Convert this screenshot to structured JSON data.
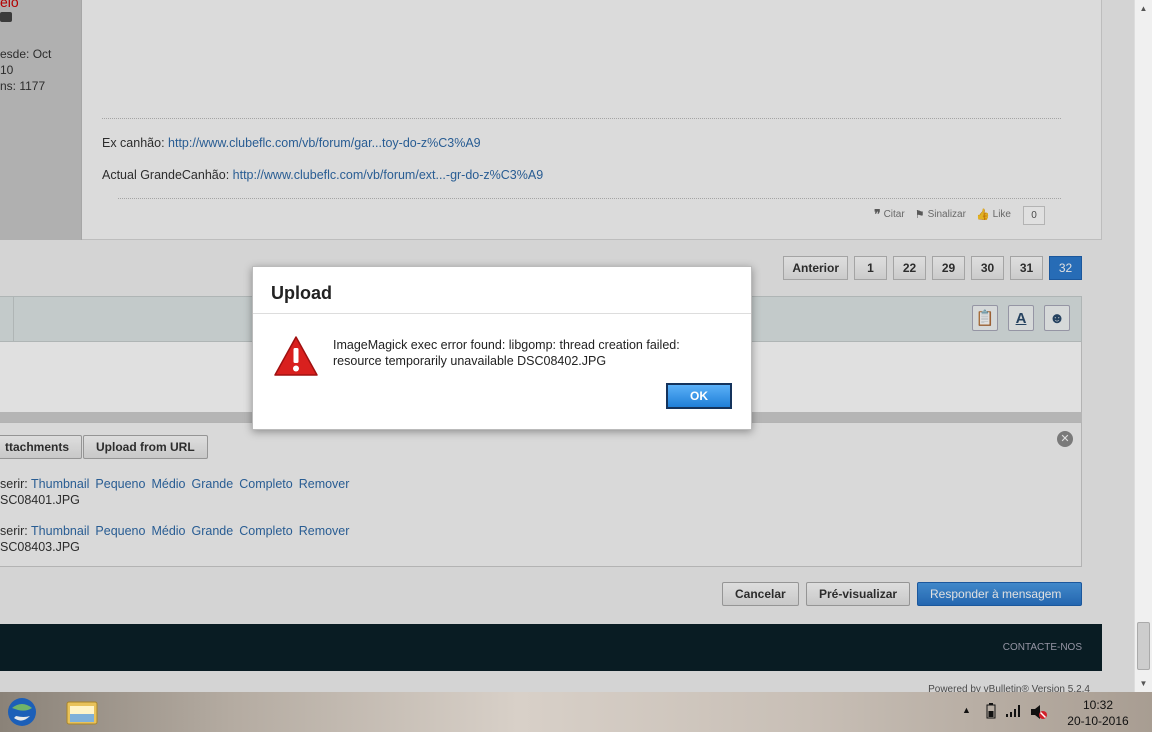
{
  "user": {
    "since_label": "esde: Oct",
    "since_year": "10",
    "posts_label": "ns: 1177"
  },
  "post": {
    "line1_label": "Ex canhão: ",
    "line1_link": "http://www.clubeflc.com/vb/forum/gar...toy-do-z%C3%A9",
    "line2_label": "Actual GrandeCanhão: ",
    "line2_link": "http://www.clubeflc.com/vb/forum/ext...-gr-do-z%C3%A9",
    "actions": {
      "quote": "Citar",
      "flag": "Sinalizar",
      "like": "Like",
      "like_count": "0"
    }
  },
  "pagination": {
    "prev": "Anterior",
    "pages": [
      "1",
      "22",
      "29",
      "30",
      "31",
      "32"
    ],
    "current": "32"
  },
  "attachments": {
    "manage_button": "ttachments",
    "url_button": "Upload from URL",
    "insert_label": "serir: ",
    "options": [
      "Thumbnail",
      "Pequeno",
      "Médio",
      "Grande",
      "Completo",
      "Remover"
    ],
    "files": [
      "SC08401.JPG",
      "SC08403.JPG"
    ]
  },
  "form": {
    "cancel": "Cancelar",
    "preview": "Pré-visualizar",
    "submit": "Responder à mensagem"
  },
  "footer": {
    "contact": "CONTACTE-NOS",
    "powered": "Powered by vBulletin® Version 5.2.4"
  },
  "dialog": {
    "title": "Upload",
    "message": "ImageMagick exec error found: libgomp: thread creation failed: resource temporarily unavailable DSC08402.JPG",
    "ok": "OK"
  },
  "taskbar": {
    "time": "10:32",
    "date": "20-10-2016"
  }
}
